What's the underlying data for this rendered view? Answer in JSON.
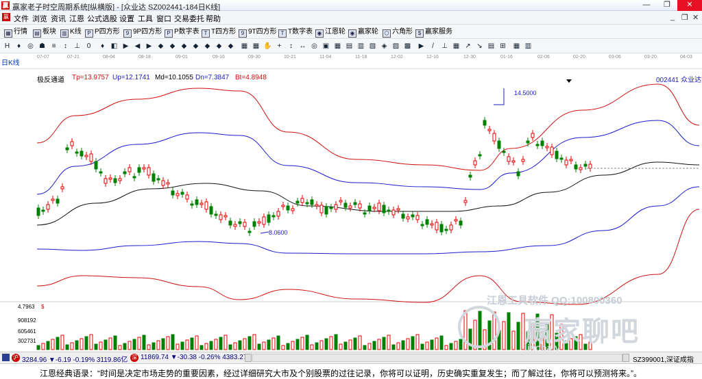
{
  "window": {
    "app_icon": "赢",
    "title": "赢家老子时空周期系统[纵横版] - [众业达  SZ002441-184日K线]",
    "minimize": "—",
    "restore": "❐",
    "close": "✕"
  },
  "menu": {
    "items": [
      "文件",
      "浏览",
      "资讯",
      "江恩",
      "公式选股",
      "设置",
      "工具",
      "窗口",
      "交易委托",
      "帮助"
    ],
    "mdi": {
      "minimize": "_",
      "restore": "❐",
      "close": "✕"
    }
  },
  "toolbar1": {
    "items": [
      {
        "label": "行情",
        "icon": "▦"
      },
      {
        "label": "板块",
        "icon": "▤"
      },
      {
        "label": "K线",
        "icon": "▥"
      },
      {
        "label": "P四方形",
        "icon": "P"
      },
      {
        "label": "9P四方形",
        "icon": "9"
      },
      {
        "label": "P数字表",
        "icon": "P"
      },
      {
        "label": "T四方形",
        "icon": "T"
      },
      {
        "label": "9T四方形",
        "icon": "9"
      },
      {
        "label": "T数字表",
        "icon": "T"
      },
      {
        "label": "江恩轮",
        "icon": "◉"
      },
      {
        "label": "赢家轮",
        "icon": "◉"
      },
      {
        "label": "六角形",
        "icon": "⬡"
      },
      {
        "label": "赢家服务",
        "icon": "$"
      }
    ]
  },
  "toolbar2": {
    "icons": [
      "H",
      "♦",
      "◎",
      "☗",
      "≡",
      "↕",
      "⊥",
      "0",
      "♦",
      "◧",
      "▶",
      "◀",
      "▶",
      "◆",
      "◆",
      "◆",
      "◆",
      "◆",
      "◆",
      "◆",
      "▦",
      "▦",
      "✋",
      "+",
      "↕",
      "↔",
      "◎",
      "▣",
      "▦",
      "▤",
      "▥",
      "▧",
      "◈",
      "▨",
      "▩",
      "▶",
      "/",
      "⊥",
      "▦",
      "↗",
      "↘",
      "▤",
      "⊞",
      "▦",
      "▥"
    ]
  },
  "datebar": {
    "period": "日K线",
    "dates": [
      "07-07",
      "07-21",
      "08-04",
      "08-18",
      "09-01",
      "09-16",
      "09-30",
      "10-21",
      "11-04",
      "11-18",
      "12-02",
      "12-16",
      "12-30",
      "01-16",
      "02-06",
      "02-20",
      "03-06",
      "03-20",
      "04-03"
    ]
  },
  "indicator": {
    "name": "极反通道",
    "tp": "Tp=13.9757",
    "up": "Up=12.1741",
    "md": "Md=10.1055",
    "dn": "Dn=7.3847",
    "bt": "Bt=4.8948",
    "stock": "002441  众业达"
  },
  "chart_data": {
    "type": "candlestick",
    "title": "",
    "xlabel": "",
    "ylabel": "",
    "annotations": [
      {
        "label": "14.5000",
        "kind": "high"
      },
      {
        "label": "8.0600",
        "kind": "low"
      }
    ],
    "current_price_label": "4.7963",
    "volume_ticks": [
      "908192",
      "605461",
      "302731"
    ],
    "indicator_lines": {
      "Tp": "red-outer",
      "Up": "blue-upper",
      "Md": "black-middle",
      "Dn": "blue-lower",
      "Bt": "red-lower"
    },
    "colors": {
      "up": "#e00000",
      "down": "#008000",
      "tp": "#d01010",
      "up_band": "#1a1acc",
      "md": "#111111",
      "dn": "#1a1acc",
      "bt": "#d01010"
    }
  },
  "watermark": {
    "software": "江恩工具软件  QQ:100800360",
    "brand": "赢家聊吧",
    "url": "liaoba.v"
  },
  "statusbar": {
    "sh_badge": "沪",
    "sh": "3284.96  ▼-6.19  -0.19%  3119.86亿",
    "sz_badge": "深",
    "sz": "11869.74  ▼-30.38  -0.26%  4383.27",
    "right": "SZ399001,深证成指"
  },
  "quote": {
    "text": "江恩经典语录：“时间是决定市场走势的重要因素，经过详细研究大市及个别股票的过往记录，你将可以证明，历史确实重复发生；而了解过往，你将可以预测将来。”。"
  }
}
